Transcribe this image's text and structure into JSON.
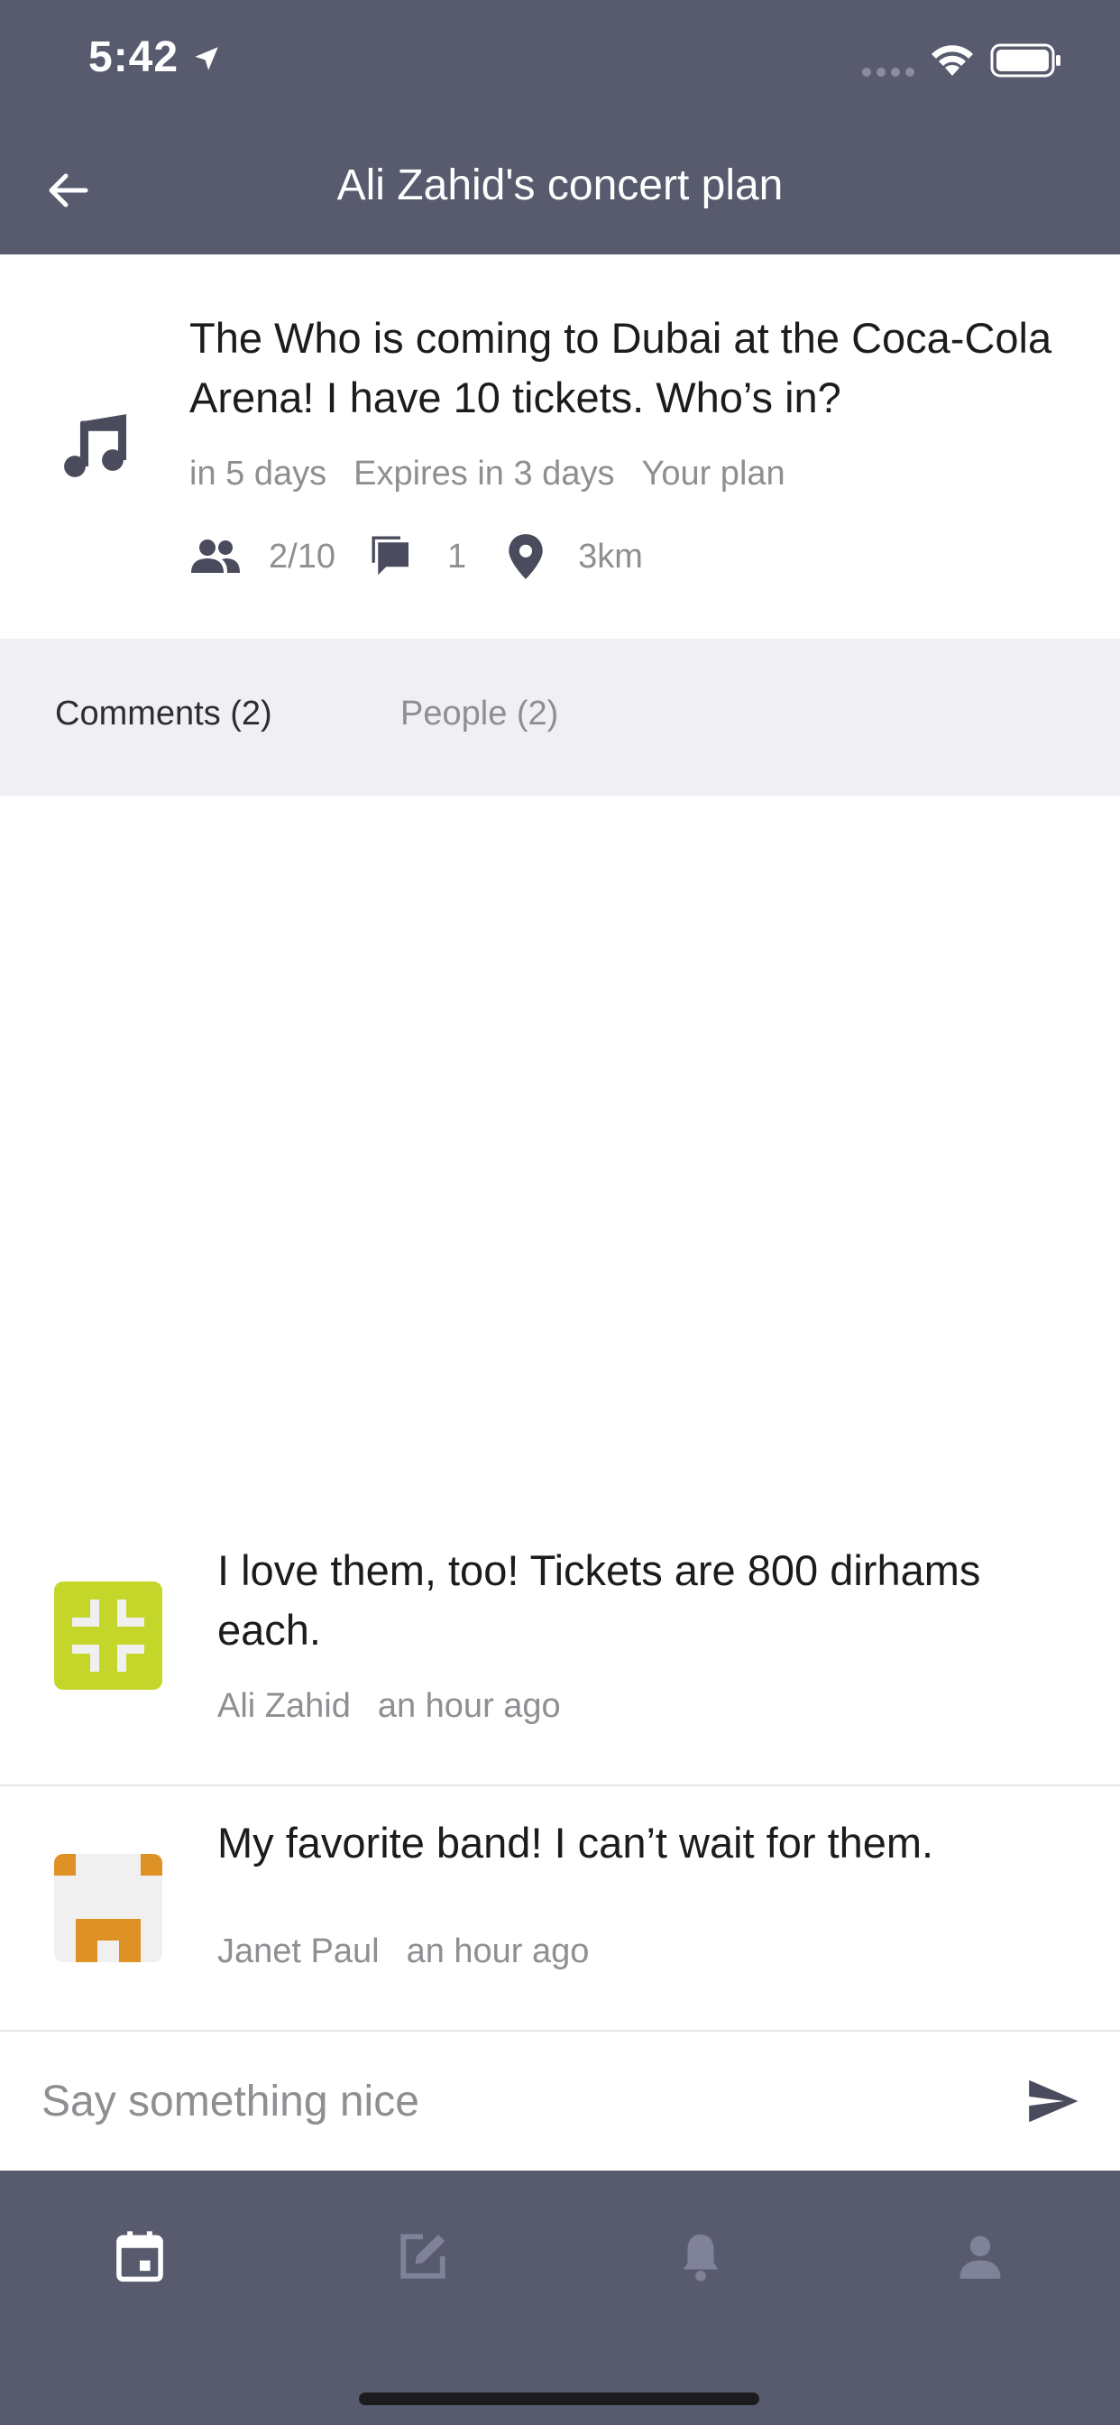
{
  "status_bar": {
    "time": "5:42"
  },
  "nav": {
    "title": "Ali Zahid's concert plan",
    "back_icon": "arrow-left-icon"
  },
  "plan": {
    "icon": "music-note-icon",
    "text": "The Who is coming to Dubai at the Coca-Cola Arena! I have 10 tickets. Who’s in?",
    "when": "in 5 days",
    "expires": "Expires in 3 days",
    "owner": "Your plan",
    "people": "2/10",
    "comments": "1",
    "distance": "3km"
  },
  "tabs": [
    {
      "label": "Comments (2)",
      "active": true
    },
    {
      "label": "People (2)",
      "active": false
    }
  ],
  "comments": [
    {
      "text": "I love them, too! Tickets are 800 dirhams each.",
      "author": "Ali Zahid",
      "time": "an hour ago",
      "avatar_color": "#c5d62a"
    },
    {
      "text": "My favorite band! I can’t wait for them.",
      "author": "Janet Paul",
      "time": "an hour ago",
      "avatar_color": "#de9226"
    }
  ],
  "composer": {
    "placeholder": "Say something nice",
    "send_icon": "send-icon"
  },
  "tab_bar": {
    "items": [
      {
        "icon": "calendar-icon",
        "active": true
      },
      {
        "icon": "edit-icon",
        "active": false
      },
      {
        "icon": "bell-icon",
        "active": false
      },
      {
        "icon": "person-icon",
        "active": false
      }
    ]
  },
  "colors": {
    "header": "#585a6d",
    "tabs_bg": "#efeff4",
    "muted": "#8e8e93",
    "inactive_icon": "#80829a"
  }
}
